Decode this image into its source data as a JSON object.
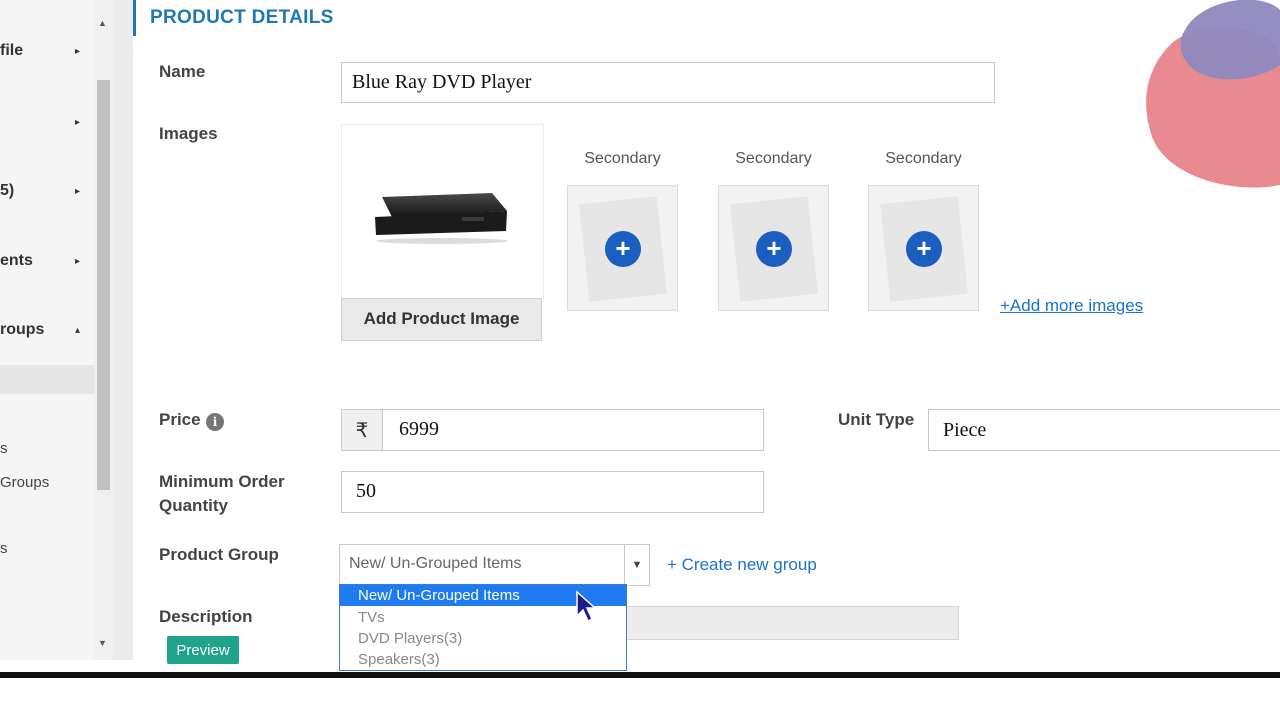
{
  "sidebar": {
    "items": [
      {
        "label": "file",
        "arrow": "▸"
      },
      {
        "label": "",
        "arrow": "▸"
      },
      {
        "label": "5)",
        "arrow": "▸"
      },
      {
        "label": "ents",
        "arrow": "▸"
      },
      {
        "label": "roups",
        "arrow": "▴"
      }
    ],
    "subitems": [
      "s",
      "Groups",
      "s"
    ]
  },
  "section": {
    "title": "PRODUCT DETAILS"
  },
  "form": {
    "name_label": "Name",
    "name_value": "Blue Ray DVD Player",
    "images_label": "Images",
    "add_image_button": "Add Product Image",
    "secondary_labels": [
      "Secondary",
      "Secondary",
      "Secondary"
    ],
    "add_more_images": "+Add more images",
    "price_label": "Price",
    "currency_symbol": "₹",
    "price_value": "6999",
    "unit_type_label": "Unit Type",
    "unit_type_value": "Piece",
    "min_order_label_line1": "Minimum Order",
    "min_order_label_line2": "Quantity",
    "min_order_value": "50",
    "product_group_label": "Product Group",
    "product_group_selected": "New/ Un-Grouped Items",
    "create_group_link": "+ Create new group",
    "description_label": "Description",
    "preview_button": "Preview"
  },
  "dropdown": {
    "options": [
      "New/ Un-Grouped Items",
      "TVs",
      "DVD Players(3)",
      "Speakers(3)"
    ],
    "highlighted_index": 0
  },
  "icons": {
    "info": "info-icon",
    "plus": "plus-icon",
    "rupee": "rupee-icon",
    "cursor": "mouse-pointer-icon"
  },
  "colors": {
    "accent": "#1f78b4",
    "link": "#1a73c9",
    "plus_button": "#1a5fbf",
    "dropdown_highlight": "#1e7bf0",
    "preview_button": "#1fa38a"
  }
}
